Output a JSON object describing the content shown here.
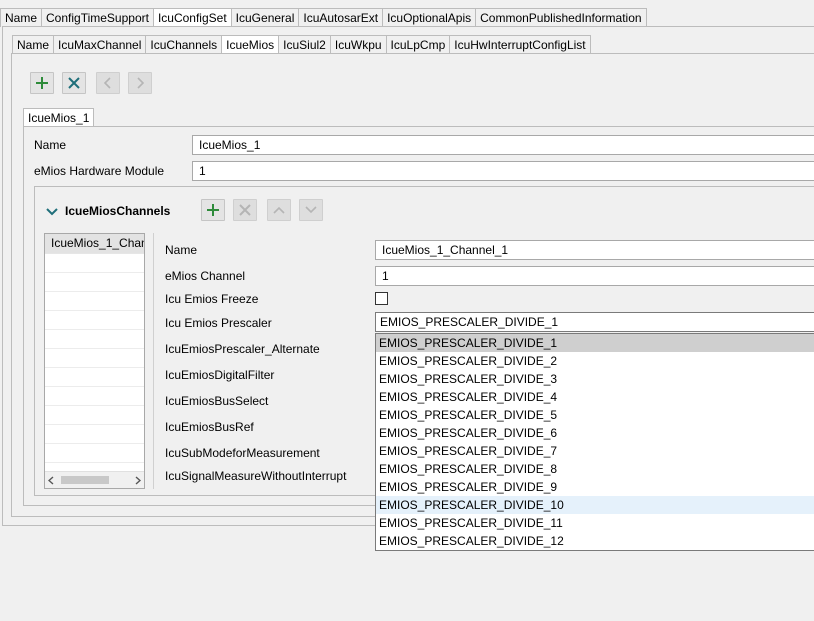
{
  "top_tabs": [
    "Name",
    "ConfigTimeSupport",
    "IcuConfigSet",
    "IcuGeneral",
    "IcuAutosarExt",
    "IcuOptionalApis",
    "CommonPublishedInformation"
  ],
  "sub_tabs": [
    "Name",
    "IcuMaxChannel",
    "IcuChannels",
    "IcueMios",
    "IcuSiul2",
    "IcuWkpu",
    "IcuLpCmp",
    "IcuHwInterruptConfigList"
  ],
  "instance_tab": "IcueMios_1",
  "fields": {
    "name_label": "Name",
    "name_value": "IcueMios_1",
    "hw_module_label": "eMios Hardware Module",
    "hw_module_value": "1"
  },
  "channels_section": {
    "title": "IcueMiosChannels",
    "list_items": [
      "IcueMios_1_Chan"
    ]
  },
  "channel_form": {
    "name_label": "Name",
    "name_value": "IcueMios_1_Channel_1",
    "channel_label": "eMios Channel",
    "channel_value": "1",
    "freeze_label": "Icu Emios Freeze",
    "freeze_checked": false,
    "prescaler_label": "Icu Emios Prescaler",
    "prescaler_value": "EMIOS_PRESCALER_DIVIDE_1",
    "prescaler_alt_label": "IcuEmiosPrescaler_Alternate",
    "digital_filter_label": "IcuEmiosDigitalFilter",
    "bus_select_label": "IcuEmiosBusSelect",
    "bus_ref_label": "IcuEmiosBusRef",
    "submode_label": "IcuSubModeforMeasurement",
    "signal_measure_label": "IcuSignalMeasureWithoutInterrupt"
  },
  "prescaler_options": [
    "EMIOS_PRESCALER_DIVIDE_1",
    "EMIOS_PRESCALER_DIVIDE_2",
    "EMIOS_PRESCALER_DIVIDE_3",
    "EMIOS_PRESCALER_DIVIDE_4",
    "EMIOS_PRESCALER_DIVIDE_5",
    "EMIOS_PRESCALER_DIVIDE_6",
    "EMIOS_PRESCALER_DIVIDE_7",
    "EMIOS_PRESCALER_DIVIDE_8",
    "EMIOS_PRESCALER_DIVIDE_9",
    "EMIOS_PRESCALER_DIVIDE_10",
    "EMIOS_PRESCALER_DIVIDE_11",
    "EMIOS_PRESCALER_DIVIDE_12"
  ],
  "colors": {
    "add_green": "#2e8b3a",
    "remove_teal": "#1f6f7a",
    "chevron_teal": "#1f6f7a"
  }
}
